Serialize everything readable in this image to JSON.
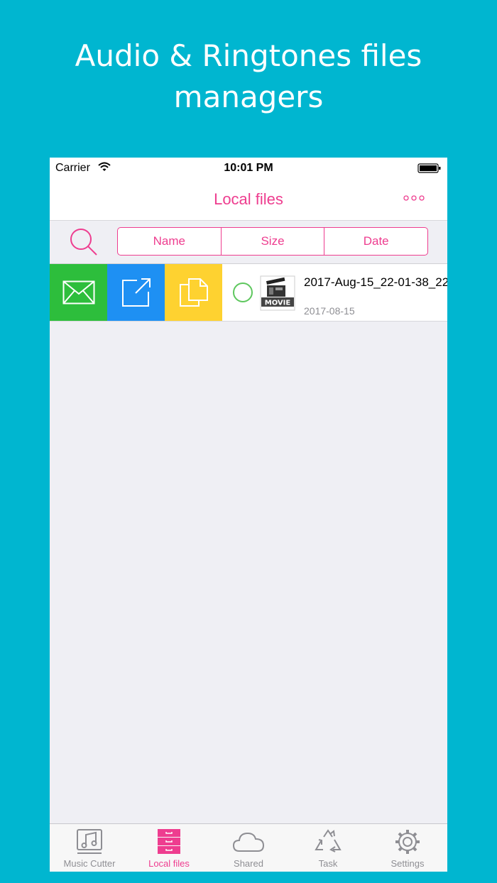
{
  "headline": {
    "line1": "Audio & Ringtones files",
    "line2": "managers"
  },
  "status_bar": {
    "carrier": "Carrier",
    "time": "10:01 PM"
  },
  "nav": {
    "title": "Local files"
  },
  "sort_options": [
    "Name",
    "Size",
    "Date"
  ],
  "files": [
    {
      "name": "2017-Aug-15_22-01-38_22",
      "date": "2017-08-15",
      "thumb_label": "MOVIE"
    }
  ],
  "tabs": [
    {
      "label": "Music Cutter",
      "icon": "music-note-icon"
    },
    {
      "label": "Local files",
      "icon": "file-cabinet-icon",
      "active": true
    },
    {
      "label": "Shared",
      "icon": "cloud-icon"
    },
    {
      "label": "Task",
      "icon": "recycle-icon"
    },
    {
      "label": "Settings",
      "icon": "gear-icon"
    }
  ],
  "colors": {
    "background": "#00b6d0",
    "accent": "#ee3d8f",
    "mail_action": "#2dbe3c",
    "share_action": "#1e90f3",
    "copy_action": "#fed230"
  }
}
